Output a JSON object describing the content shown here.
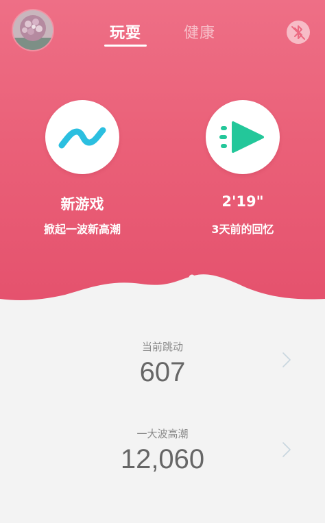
{
  "header": {
    "tabs": [
      {
        "label": "玩耍",
        "active": true
      },
      {
        "label": "健康",
        "active": false
      }
    ],
    "bluetooth_icon": "bluetooth-off-icon",
    "avatar_icon": "flower-avatar"
  },
  "colors": {
    "hero_gradient_top": "#ee6f86",
    "hero_gradient_bottom": "#e4506c",
    "wave_icon": "#2bbfe0",
    "play_icon": "#23c79a",
    "background": "#f3f3f3"
  },
  "actions": {
    "new_game": {
      "icon": "wave-icon",
      "title": "新游戏",
      "subtitle": "掀起一波新高潮"
    },
    "memory": {
      "icon": "fast-play-icon",
      "title": "2'19\"",
      "subtitle": "3天前的回忆"
    }
  },
  "stats": [
    {
      "label": "当前跳动",
      "value": "607"
    },
    {
      "label": "一大波高潮",
      "value": "12,060"
    }
  ]
}
